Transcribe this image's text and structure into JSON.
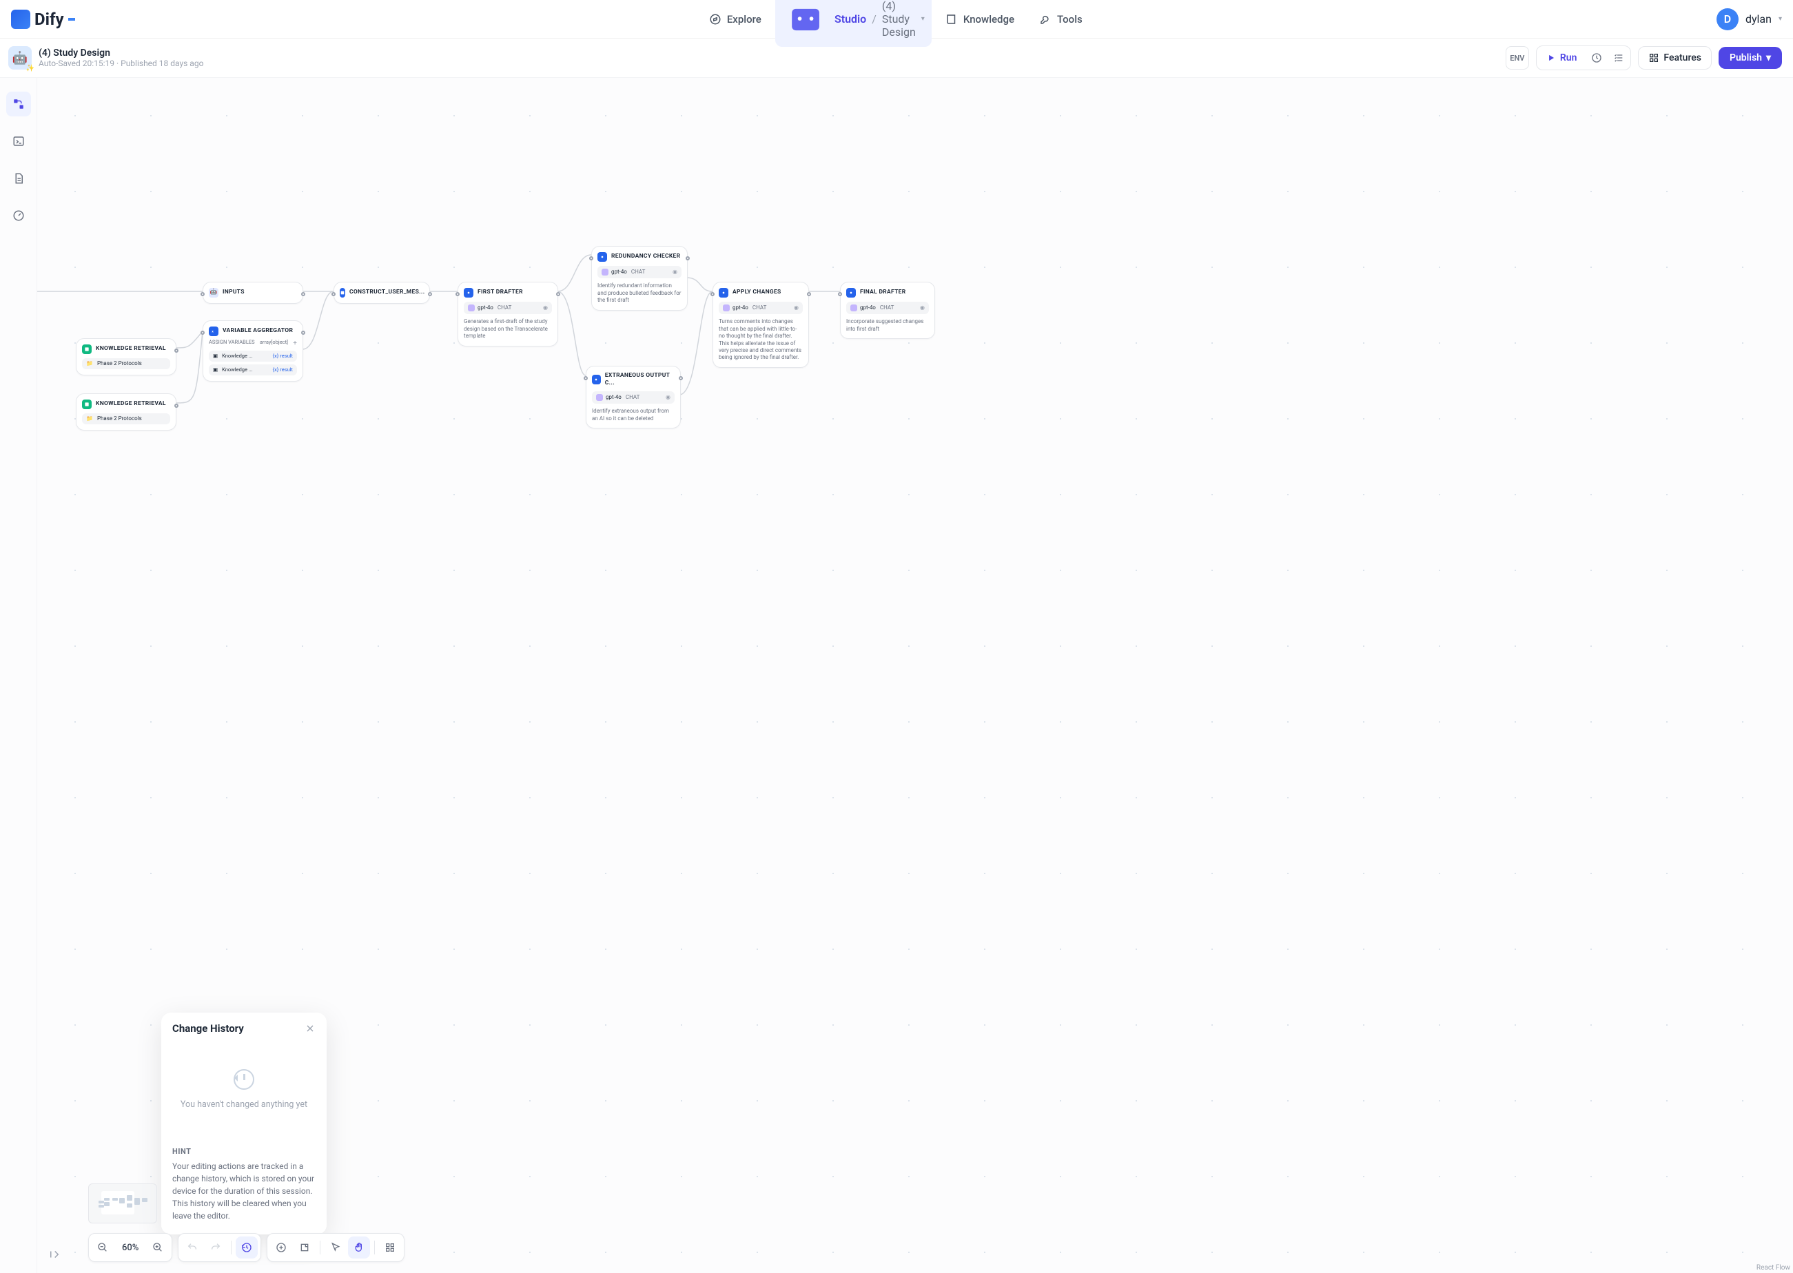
{
  "brand": "Dify",
  "nav": {
    "explore": "Explore",
    "studio": "Studio",
    "app_name": "(4) Study Design",
    "knowledge": "Knowledge",
    "tools": "Tools"
  },
  "user": {
    "initial": "D",
    "name": "dylan"
  },
  "app": {
    "emoji": "🤖",
    "title": "(4) Study Design",
    "subtitle": "Auto-Saved 20:15:19 · Published 18 days ago"
  },
  "toolbar": {
    "env": "ENV",
    "run": "Run",
    "features": "Features",
    "publish": "Publish"
  },
  "nodes": {
    "inputs": {
      "title": "INPUTS",
      "emoji": "🤖"
    },
    "kr1": {
      "title": "KNOWLEDGE RETRIEVAL",
      "folder": "Phase 2 Protocols"
    },
    "kr2": {
      "title": "KNOWLEDGE RETRIEVAL",
      "folder": "Phase 2 Protocols"
    },
    "va": {
      "title": "VARIABLE AGGREGATOR",
      "assign": "ASSIGN VARIABLES",
      "type": "array[object]",
      "k1": "Knowledge ...",
      "k2": "Knowledge ...",
      "res": "result"
    },
    "cum": {
      "title": "CONSTRUCT_USER_MES..."
    },
    "first": {
      "title": "FIRST DRAFTER",
      "model": "gpt-4o",
      "tag": "CHAT",
      "desc": "Generates a first-draft of the study design based on the Transcelerate template"
    },
    "red": {
      "title": "REDUNDANCY CHECKER",
      "model": "gpt-4o",
      "tag": "CHAT",
      "desc": "Identify redundant information and produce bulleted feedback for the first draft"
    },
    "ext": {
      "title": "EXTRANEOUS OUTPUT C...",
      "model": "gpt-4o",
      "tag": "CHAT",
      "desc": "Identify extraneous output from an AI so it can be deleted"
    },
    "apply": {
      "title": "APPLY CHANGES",
      "model": "gpt-4o",
      "tag": "CHAT",
      "desc": "Turns comments into changes that can be applied with little-to-no thought by the final drafter. This helps alleviate the issue of very precise and direct comments being ignored by the final drafter."
    },
    "final": {
      "title": "FINAL DRAFTER",
      "model": "gpt-4o",
      "tag": "CHAT",
      "desc": "Incorporate suggested changes into first draft"
    }
  },
  "change_history": {
    "title": "Change History",
    "empty": "You haven't changed anything yet",
    "hint_title": "HINT",
    "hint_body": "Your editing actions are tracked in a change history, which is stored on your device for the duration of this session. This history will be cleared when you leave the editor."
  },
  "zoom": "60%",
  "attribution": "React Flow"
}
